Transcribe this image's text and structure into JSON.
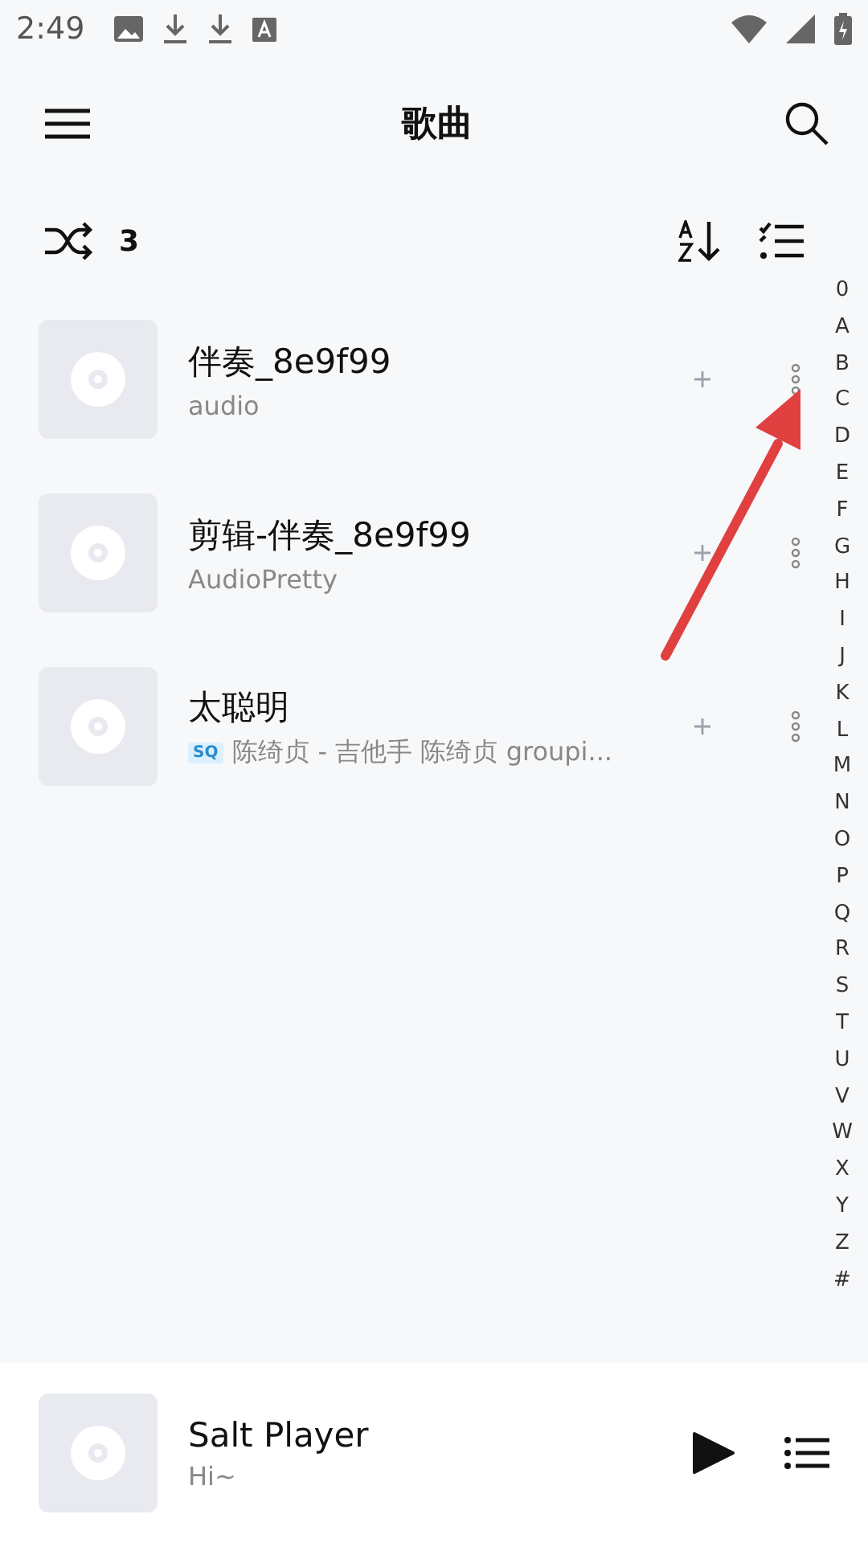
{
  "status_bar": {
    "time": "2:49"
  },
  "top_bar": {
    "title": "歌曲"
  },
  "toolbar": {
    "count": "3"
  },
  "songs": [
    {
      "title": "伴奏_8e9f99",
      "subtitle": "audio"
    },
    {
      "title": "剪辑-伴奏_8e9f99",
      "subtitle": "AudioPretty"
    },
    {
      "title": "太聪明",
      "badge": "SQ",
      "subtitle": "陈绮贞 - 吉他手 陈绮贞 groupi..."
    }
  ],
  "index": [
    "0",
    "A",
    "B",
    "C",
    "D",
    "E",
    "F",
    "G",
    "H",
    "I",
    "J",
    "K",
    "L",
    "M",
    "N",
    "O",
    "P",
    "Q",
    "R",
    "S",
    "T",
    "U",
    "V",
    "W",
    "X",
    "Y",
    "Z",
    "#"
  ],
  "mini_player": {
    "title": "Salt Player",
    "subtitle": "Hi~"
  }
}
